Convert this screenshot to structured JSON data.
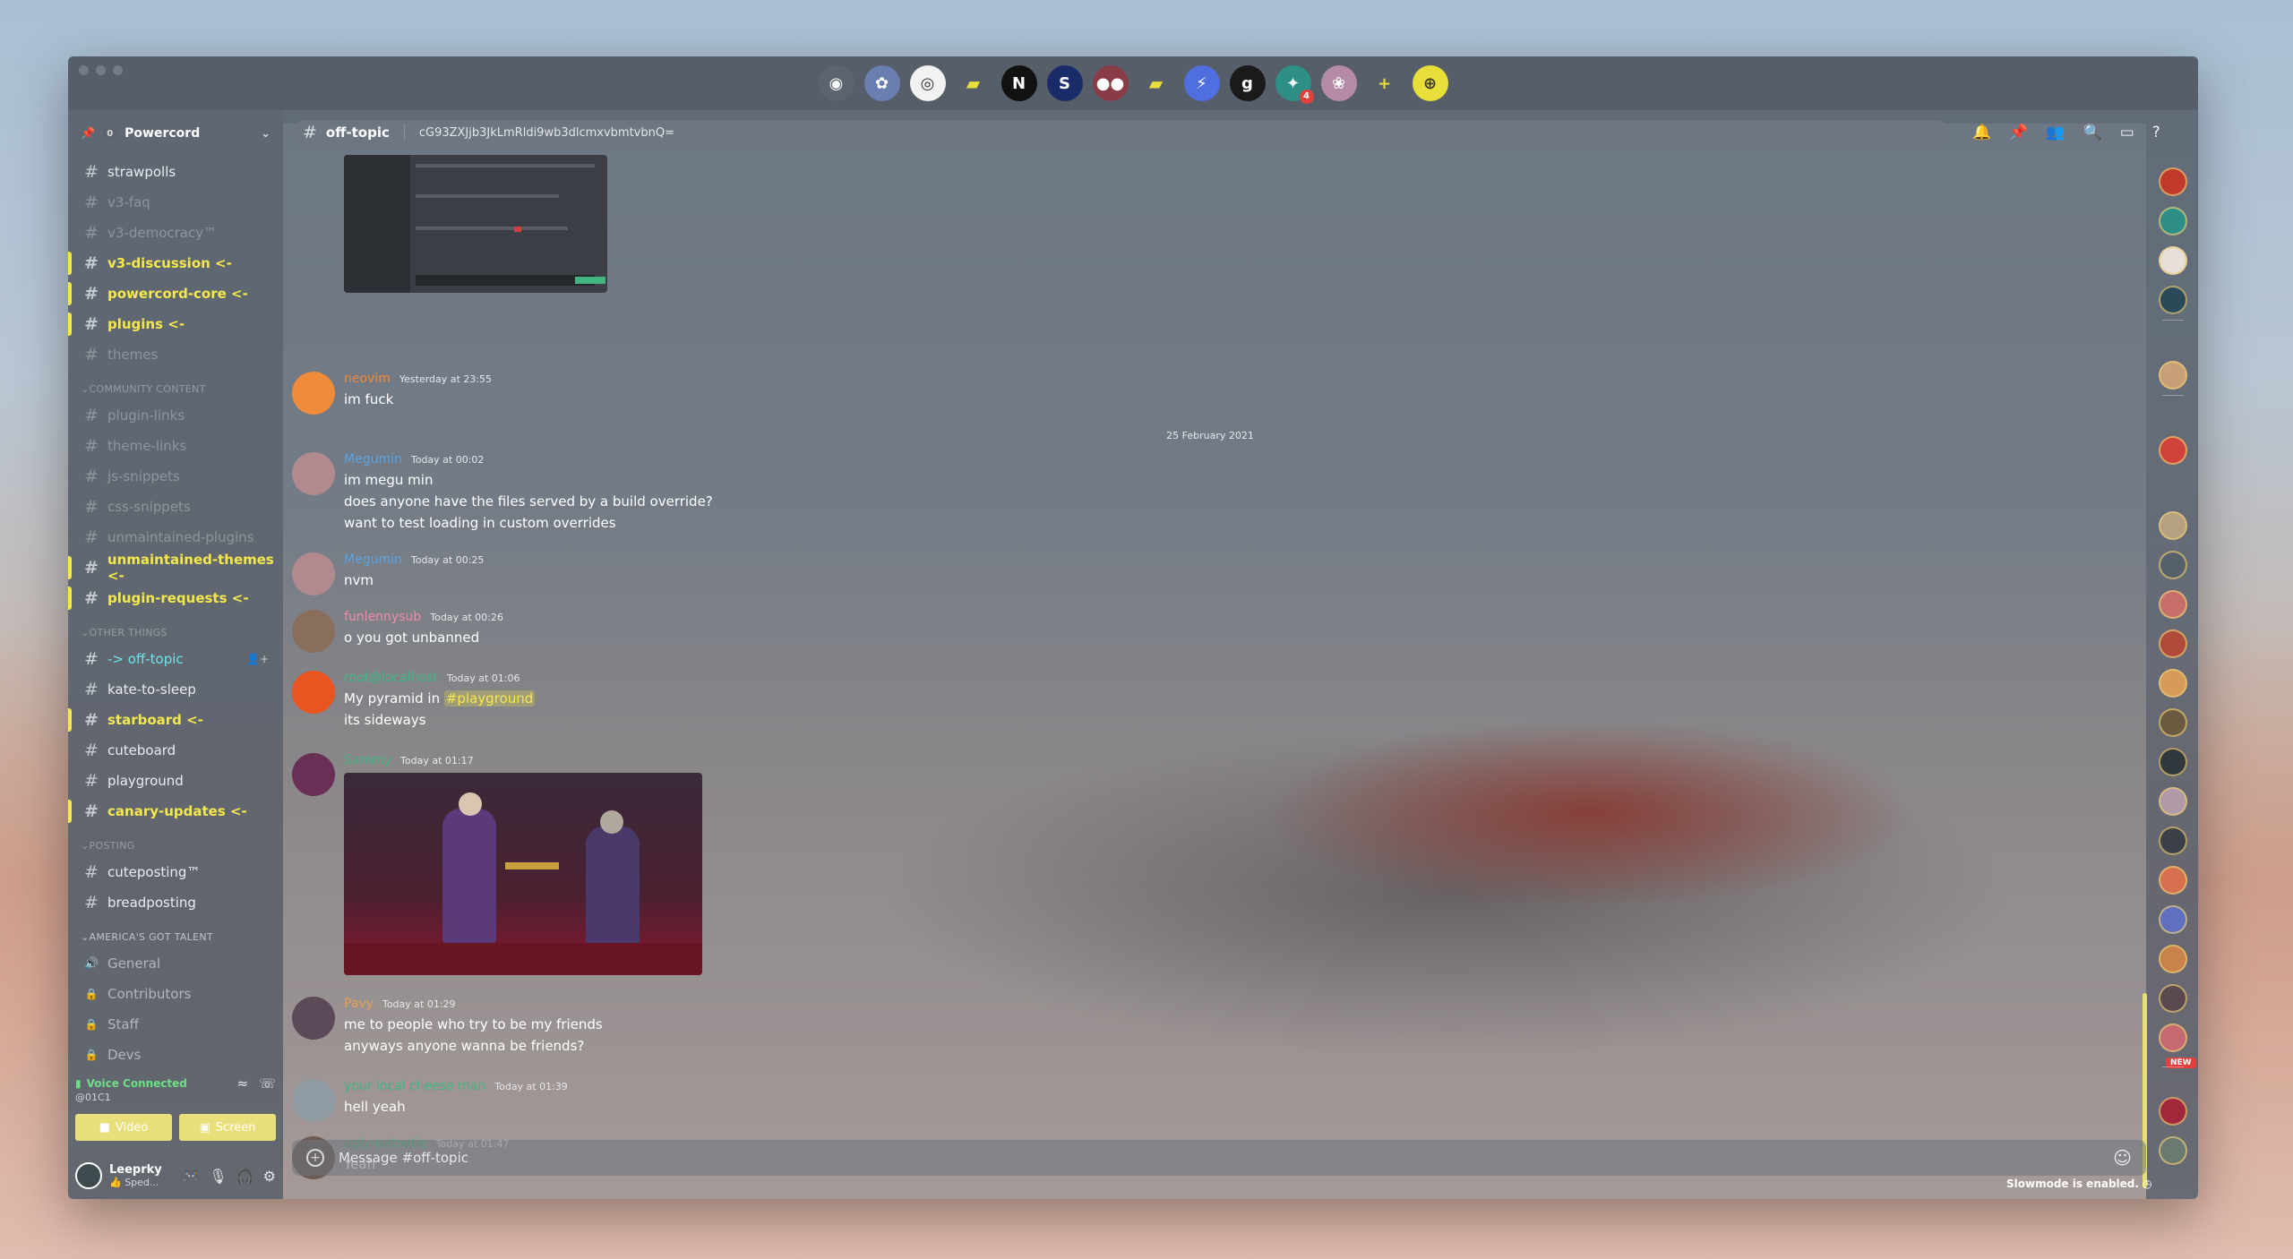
{
  "server_bar": {
    "servers": [
      {
        "name": "discord-home",
        "color": "#5b6470",
        "glyph": "◉",
        "badge": ""
      },
      {
        "name": "server-anime",
        "color": "#6a7fb0",
        "glyph": "✿",
        "badge": ""
      },
      {
        "name": "server-snail",
        "color": "#f2f2f2",
        "glyph": "◎",
        "badge": ""
      },
      {
        "name": "folder-1",
        "color": "transparent",
        "glyph": "▰",
        "badge": "",
        "folder": true
      },
      {
        "name": "server-n",
        "color": "#111111",
        "glyph": "N",
        "badge": ""
      },
      {
        "name": "server-s",
        "color": "#1a2b6a",
        "glyph": "S",
        "badge": ""
      },
      {
        "name": "server-eyes",
        "color": "#8a3c46",
        "glyph": "●●",
        "badge": ""
      },
      {
        "name": "folder-2",
        "color": "transparent",
        "glyph": "▰",
        "badge": "",
        "folder": true
      },
      {
        "name": "server-powercord",
        "color": "#4f6ee0",
        "glyph": "⚡",
        "badge": "",
        "active": true
      },
      {
        "name": "server-g",
        "color": "#1a1a1a",
        "glyph": "g",
        "badge": ""
      },
      {
        "name": "server-group",
        "color": "#2e8f86",
        "glyph": "✦",
        "badge": "4"
      },
      {
        "name": "server-pink",
        "color": "#b48aa6",
        "glyph": "❀",
        "badge": ""
      },
      {
        "name": "add-server",
        "color": "transparent",
        "glyph": "+",
        "badge": ""
      },
      {
        "name": "explore",
        "color": "#e8df3a",
        "glyph": "⊕",
        "badge": ""
      }
    ]
  },
  "guild": {
    "name": "Powercord",
    "boost": "0",
    "chevron": "⌄"
  },
  "sidebar": {
    "sections": [
      {
        "type": "channel",
        "name": "strawpolls",
        "state": "normal"
      },
      {
        "type": "channel",
        "name": "v3-faq",
        "state": "muted"
      },
      {
        "type": "channel",
        "name": "v3-democracy™",
        "state": "muted"
      },
      {
        "type": "channel",
        "name": "v3-discussion <-",
        "state": "unread"
      },
      {
        "type": "channel",
        "name": "powercord-core <-",
        "state": "unread"
      },
      {
        "type": "channel",
        "name": "plugins <-",
        "state": "unread"
      },
      {
        "type": "channel",
        "name": "themes",
        "state": "muted"
      },
      {
        "type": "category",
        "name": "Community Content",
        "state": "muted"
      },
      {
        "type": "channel",
        "name": "plugin-links",
        "state": "muted"
      },
      {
        "type": "channel",
        "name": "theme-links",
        "state": "muted"
      },
      {
        "type": "channel",
        "name": "js-snippets",
        "state": "muted"
      },
      {
        "type": "channel",
        "name": "css-snippets",
        "state": "muted"
      },
      {
        "type": "channel",
        "name": "unmaintained-plugins",
        "state": "muted"
      },
      {
        "type": "channel",
        "name": "unmaintained-themes <-",
        "state": "unread"
      },
      {
        "type": "channel",
        "name": "plugin-requests <-",
        "state": "unread"
      },
      {
        "type": "category",
        "name": "Other Things",
        "state": "muted"
      },
      {
        "type": "channel",
        "name": "-> off-topic",
        "state": "selected"
      },
      {
        "type": "channel",
        "name": "kate-to-sleep",
        "state": "normal"
      },
      {
        "type": "channel",
        "name": "starboard <-",
        "state": "unread"
      },
      {
        "type": "channel",
        "name": "cuteboard",
        "state": "normal"
      },
      {
        "type": "channel",
        "name": "playground",
        "state": "normal"
      },
      {
        "type": "channel",
        "name": "canary-updates <-",
        "state": "unread"
      },
      {
        "type": "category",
        "name": "Posting",
        "state": "muted"
      },
      {
        "type": "channel",
        "name": "cuteposting™",
        "state": "normal"
      },
      {
        "type": "channel",
        "name": "breadposting",
        "state": "normal"
      },
      {
        "type": "category",
        "name": "America's Got Talent",
        "state": "light"
      },
      {
        "type": "voice",
        "name": "General",
        "state": "normal"
      },
      {
        "type": "locked",
        "name": "Contributors",
        "state": "normal"
      },
      {
        "type": "locked",
        "name": "Staff",
        "state": "normal"
      },
      {
        "type": "locked",
        "name": "Devs",
        "state": "normal"
      }
    ]
  },
  "voice": {
    "status": "Voice Connected",
    "channel": "@01C1",
    "video_label": "Video",
    "screen_label": "Screen"
  },
  "user": {
    "name": "Leeprky",
    "status": "👍 Sped..."
  },
  "channel_header": {
    "name": "off-topic",
    "topic": "cG93ZXJjb3JkLmRldi9wb3dlcmxvbmtvbnQ="
  },
  "messages": {
    "date_divider": "25 February 2021",
    "items": [
      {
        "author": "neovim",
        "color": "#f08b3a",
        "time": "Yesterday at 23:55",
        "lines": [
          "im fuck"
        ],
        "avatar": "#f08b3a"
      },
      {
        "author": "Megumin",
        "color": "#5aa3e0",
        "time": "Today at 00:02",
        "lines": [
          "im megu min",
          "does anyone have the files served by a build override?",
          "want to test loading in custom overrides"
        ],
        "avatar": "#b08a8e"
      },
      {
        "author": "Megumin",
        "color": "#5aa3e0",
        "time": "Today at 00:25",
        "lines": [
          "nvm"
        ],
        "avatar": "#b08a8e"
      },
      {
        "author": "funlennysub",
        "color": "#f08aa8",
        "time": "Today at 00:26",
        "lines": [
          "o you got unbanned"
        ],
        "avatar": "#8a6e5c"
      },
      {
        "author": "root@localhost",
        "color": "#43b581",
        "time": "Today at 01:06",
        "lines": [
          "My pyramid in ",
          "its sideways"
        ],
        "mention": "#playground",
        "avatar": "#e95420"
      },
      {
        "author": "Sammy",
        "color": "#43b581",
        "time": "Today at 01:17",
        "lines": [],
        "avatar": "#6a2f55"
      },
      {
        "author": "Pavy",
        "color": "#e8a050",
        "time": "Today at 01:29",
        "lines": [
          "me to people who try to be my friends",
          "anyways anyone wanna be friends?"
        ],
        "avatar": "#5c4a58"
      },
      {
        "author": "your local cheese man",
        "color": "#43b581",
        "time": "Today at 01:39",
        "lines": [
          "hell yeah"
        ],
        "avatar": "#8f9aa2"
      },
      {
        "author": "ugly-patootie",
        "color": "#43b581",
        "time": "Today at 01:47",
        "lines": [
          "Yeah"
        ],
        "avatar": "#6e5a50"
      }
    ]
  },
  "new_badge": "NEW",
  "composer": {
    "placeholder": "Message #off-topic"
  },
  "slowmode": "Slowmode is enabled.",
  "member_colors": [
    "#c0392b",
    "#2e8f86",
    "#e8e0d8",
    "#2a4a5a",
    "#c8a078",
    "#d0433a",
    "#b5a080",
    "#55606a",
    "#c86e6a",
    "#b04a3a",
    "#d69a5a",
    "#6a5a40",
    "#30373d",
    "#b09aa8",
    "#3a3f48",
    "#d87050",
    "#6070c0",
    "#c8834a",
    "#5a4a50",
    "#c46a70",
    "#a0283a",
    "#6a7a70"
  ]
}
